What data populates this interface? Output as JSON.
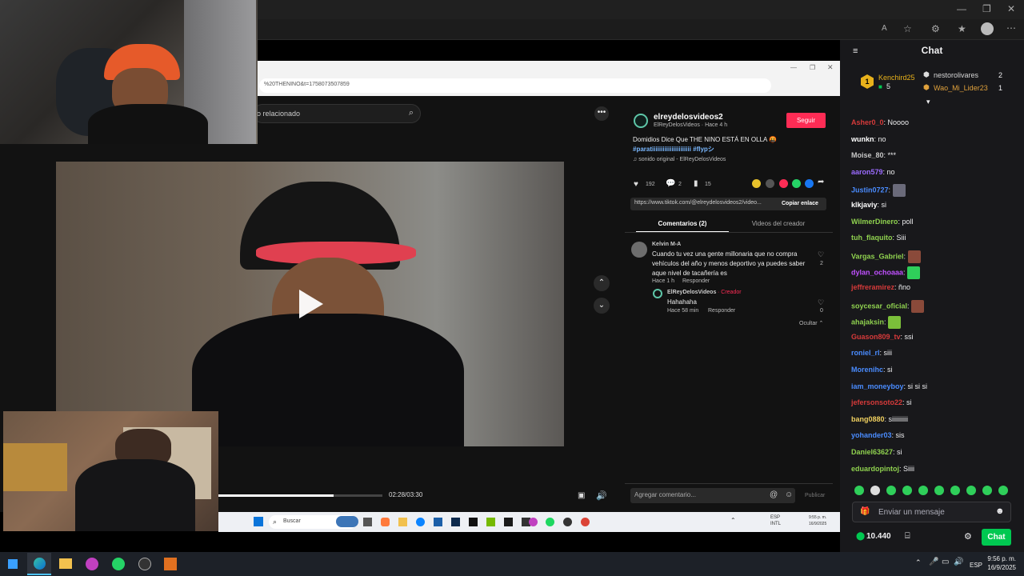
{
  "colors": {
    "chat_accent": "#00c851",
    "follow_red": "#fe2c55",
    "chat_bg": "#18181b"
  },
  "inner_browser": {
    "url": "%20THENINO&t=1758073507859"
  },
  "tiktok": {
    "search_placeholder": "o relacionado",
    "video": {
      "time": "02:28/03:30",
      "progress": 0.7
    },
    "author": {
      "username": "elreydelosvideos2",
      "display": "ElReyDelosVideos · Hace 4 h",
      "follow": "Seguir"
    },
    "description": "Domidios Dice Que THE NINO ESTÁ EN OLLA 🤬",
    "hashtags": "#paratiiiiiiiiiiiiiiiiiiiiii #flypシ",
    "sound": "♫  sonido original - ElReyDelosVideos",
    "stats": {
      "likes": "192",
      "comments": "2",
      "saves": "15"
    },
    "link": "https://www.tiktok.com/@elreydelosvideos2/video...",
    "copy_link": "Copiar enlace",
    "tabs": {
      "comments": "Comentarios (2)",
      "creator": "Videos del creador"
    },
    "comments": [
      {
        "user": "Kelvin M-A",
        "text": "Cuando tu vez una gente millonaria que no compra vehículos del año y menos deportivo ya puedes saber aque nivel de tacañería es",
        "time": "Hace 1 h",
        "reply": "Responder",
        "likes": "2"
      }
    ],
    "reply": {
      "user": "ElReyDelosVideos",
      "badge": "· Creador",
      "text": "Hahahaha",
      "time": "Hace 58 min",
      "reply_label": "Responder",
      "likes": "0"
    },
    "hide": "Ocultar ⌃",
    "add_comment": "Agregar comentario...",
    "publish": "Publicar"
  },
  "inner_taskbar": {
    "search": "Buscar",
    "lang": "ESP\nINTL",
    "clock": "9:55 p. m.\n16/9/2025"
  },
  "chat": {
    "title": "Chat",
    "leaderboard": [
      {
        "rank": "1",
        "name": "Kenchird25",
        "count": "5",
        "color": "#e8b11b"
      },
      {
        "name": "nestorolivares",
        "count": "2",
        "color": "#d6d6d6"
      },
      {
        "name": "Wao_Mi_Lider23",
        "count": "1",
        "color": "#e0a13c"
      }
    ],
    "messages": [
      {
        "user": "Asher0_0",
        "text": ": Noooo",
        "color": "#d63a3a"
      },
      {
        "user": "wunkn",
        "text": ": no",
        "color": "#ffffff"
      },
      {
        "user": "Moise_80",
        "text": ": ***",
        "color": "#c8c8c8"
      },
      {
        "user": "aaron579",
        "text": ": no",
        "color": "#9b6bff"
      },
      {
        "user": "Justin0727",
        "text": ": ",
        "color": "#4a8cff",
        "emote": true
      },
      {
        "user": "klkjaviy",
        "text": ": si",
        "color": "#ffffff"
      },
      {
        "user": "WilmerDinero",
        "text": ": poll",
        "color": "#8fd14f"
      },
      {
        "user": "tuh_flaquito",
        "text": ": Siii",
        "color": "#8fd14f"
      },
      {
        "user": "Vargas_Gabriel",
        "text": ": ",
        "color": "#8fd14f",
        "emote": true
      },
      {
        "user": "dylan_ochoaaa",
        "text": ": ",
        "color": "#c050ff",
        "emote": true
      },
      {
        "user": "jeffreramirez",
        "text": ": ñno",
        "color": "#d63a3a"
      },
      {
        "user": "soycesar_oficial",
        "text": ": ",
        "color": "#8fd14f",
        "emote": true
      },
      {
        "user": "ahajaksin",
        "text": ": ",
        "color": "#8fd14f",
        "emote": true
      },
      {
        "user": "Guason809_tv",
        "text": ": ssi",
        "color": "#d63a3a"
      },
      {
        "user": "roniel_rl",
        "text": ": siii",
        "color": "#4a8cff"
      },
      {
        "user": "Morenihc",
        "text": ": si",
        "color": "#4a8cff"
      },
      {
        "user": "iam_moneyboy",
        "text": ": si si si",
        "color": "#4a8cff"
      },
      {
        "user": "jefersonsoto22",
        "text": ": si",
        "color": "#d63a3a"
      },
      {
        "user": "bang0880",
        "text": ": siiiiiiiiii",
        "color": "#f0d060"
      },
      {
        "user": "yohander03",
        "text": ": sis",
        "color": "#4a8cff"
      },
      {
        "user": "Daniel63627",
        "text": ": si",
        "color": "#8fd14f"
      },
      {
        "user": "eduardopintoj",
        "text": ": Siiii",
        "color": "#8fd14f"
      }
    ],
    "input_placeholder": "Enviar un mensaje",
    "points": "10.440",
    "chat_button": "Chat"
  },
  "taskbar": {
    "lang": "ESP",
    "time": "9:56 p. m.",
    "date": "16/9/2025"
  }
}
